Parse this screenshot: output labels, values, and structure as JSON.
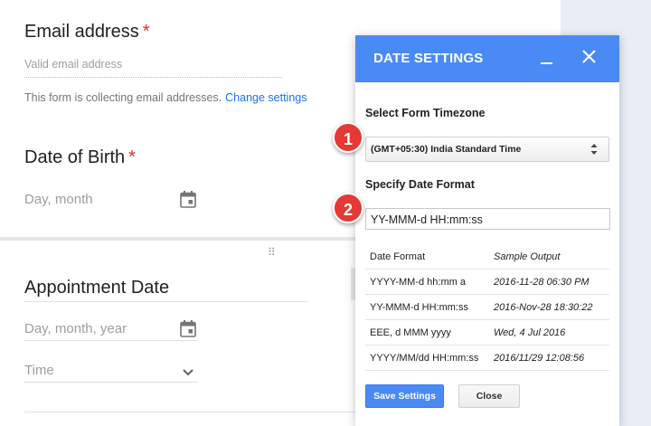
{
  "form": {
    "email": {
      "title": "Email address",
      "required_mark": "*",
      "placeholder": "Valid email address",
      "collecting_note": "This form is collecting email addresses.",
      "change_link": "Change settings"
    },
    "dob": {
      "title": "Date of Birth",
      "required_mark": "*",
      "placeholder": "Day, month",
      "icon": "calendar-icon"
    },
    "drag_handle": "⠿",
    "appointment": {
      "title": "Appointment Date",
      "date_placeholder": "Day, month, year",
      "date_icon": "calendar-icon",
      "time_placeholder": "Time",
      "time_icon": "chevron-down-icon"
    }
  },
  "annotations": {
    "badge1": "1",
    "badge2": "2",
    "color": "#e53935"
  },
  "dialog": {
    "title": "DATE SETTINGS",
    "header_color": "#4a8af4",
    "minimize_icon": "minimize-icon",
    "close_icon": "close-icon",
    "timezone_label": "Select Form Timezone",
    "timezone_value": "(GMT+05:30) India Standard Time",
    "date_format_label": "Specify Date Format",
    "date_format_value": "YY-MMM-d HH:mm:ss",
    "table": {
      "headers": [
        "Date Format",
        "Sample Output"
      ],
      "rows": [
        [
          "YYYY-MM-d hh:mm a",
          "2016-11-28 06:30 PM"
        ],
        [
          "YY-MMM-d HH:mm:ss",
          "2016-Nov-28 18:30:22"
        ],
        [
          "EEE, d MMM yyyy",
          "Wed, 4 Jul 2016"
        ],
        [
          "YYYY/MM/dd HH:mm:ss",
          "2016/11/29 12:08:56"
        ]
      ]
    },
    "save_label": "Save Settings",
    "close_label": "Close"
  }
}
